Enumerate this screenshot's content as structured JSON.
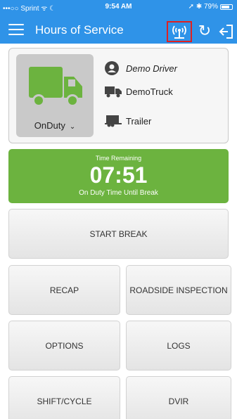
{
  "status_bar": {
    "carrier": "•••○○ Sprint ᯤ ☾",
    "time": "9:54 AM",
    "indicators": "➚ ✱ 79%",
    "battery_level": 0.79
  },
  "header": {
    "title": "Hours of Service",
    "refresh_glyph": "↻",
    "accent_color": "#2f93e8",
    "highlight_color": "#e02020"
  },
  "driver": {
    "name": "Demo Driver",
    "truck": "DemoTruck",
    "trailer": "Trailer",
    "duty_status": "OnDuty",
    "chevron": "⌄"
  },
  "time_remaining": {
    "label": "Time Remaining",
    "value": "07:51",
    "subtitle": "On Duty Time Until Break",
    "color": "#6cb33f"
  },
  "buttons": {
    "start_break": "START BREAK",
    "recap": "RECAP",
    "roadside_inspection": "ROADSIDE INSPECTION",
    "options": "OPTIONS",
    "logs": "LOGS",
    "shift_cycle": "SHIFT/CYCLE",
    "dvir": "DVIR"
  }
}
